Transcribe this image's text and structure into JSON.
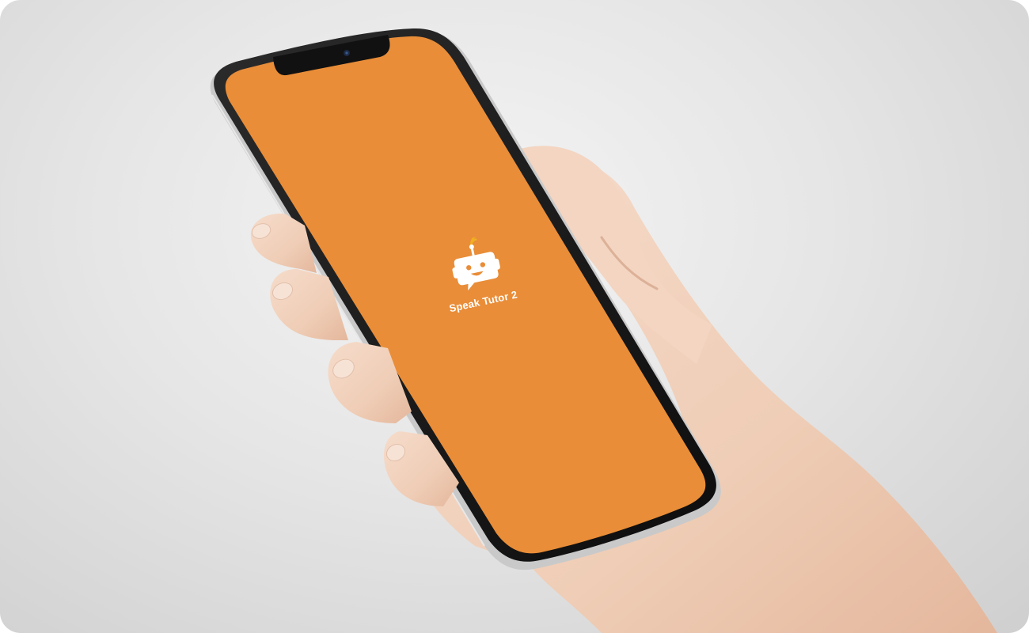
{
  "app": {
    "title": "Speak Tutor 2",
    "logo_icon": "robot-chat-icon"
  },
  "colors": {
    "splash_background": "#E98D38",
    "logo_foreground": "#FFFFFF",
    "logo_accent": "#F0B020",
    "device_frame": "#1A1A1A",
    "skin_tone": "#F2D3BE"
  }
}
